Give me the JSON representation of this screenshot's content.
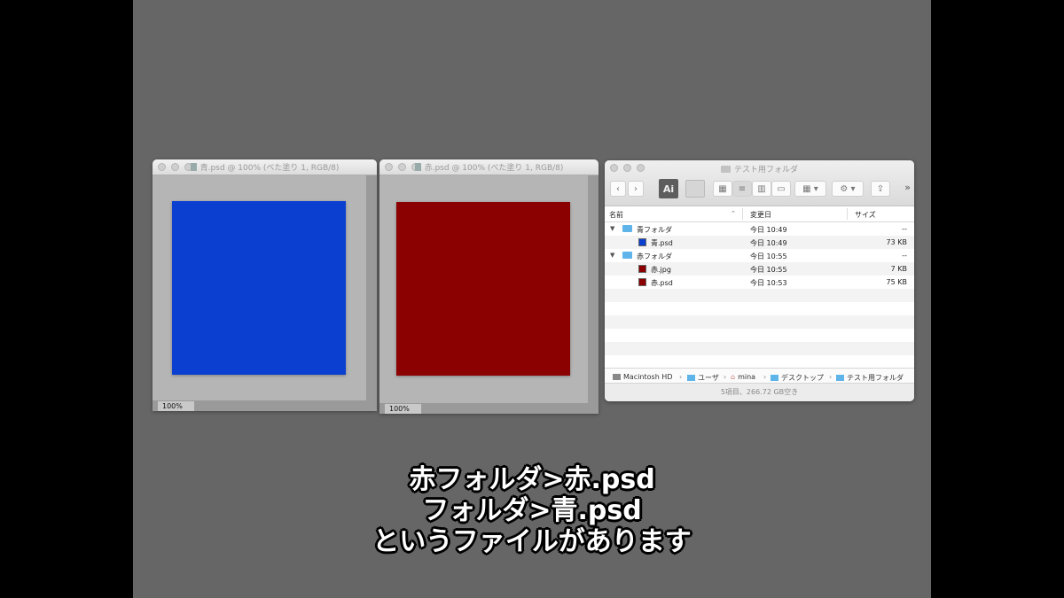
{
  "ps_blue": {
    "title": "青.psd @ 100% (べた塗り 1, RGB/8)",
    "zoom": "100%",
    "fill_color": "#0a3fd0"
  },
  "ps_red": {
    "title": "赤.psd @ 100% (べた塗り 1, RGB/8)",
    "zoom": "100%",
    "fill_color": "#8b0000"
  },
  "finder": {
    "title": "テスト用フォルダ",
    "toolbar": {
      "back_icon": "chevron-left-icon",
      "forward_icon": "chevron-right-icon",
      "ai_label": "Ai",
      "more": "»"
    },
    "columns": {
      "name": "名前",
      "modified": "変更日",
      "size": "サイズ"
    },
    "rows": [
      {
        "name": "青フォルダ",
        "modified": "今日 10:49",
        "size": "--",
        "kind": "folder"
      },
      {
        "name": "青.psd",
        "modified": "今日 10:49",
        "size": "73 KB",
        "kind": "file",
        "color": "#0a3fd0"
      },
      {
        "name": "赤フォルダ",
        "modified": "今日 10:55",
        "size": "--",
        "kind": "folder"
      },
      {
        "name": "赤.jpg",
        "modified": "今日 10:55",
        "size": "7 KB",
        "kind": "file",
        "color": "#8b0000"
      },
      {
        "name": "赤.psd",
        "modified": "今日 10:53",
        "size": "75 KB",
        "kind": "file",
        "color": "#8b0000"
      }
    ],
    "path": [
      "Macintosh HD",
      "ユーザ",
      "mina",
      "デスクトップ",
      "テスト用フォルダ"
    ],
    "status": "5項目、266.72 GB空き"
  },
  "caption": {
    "line1": "赤フォルダ>赤.psd",
    "line2": "フォルダ>青.psd",
    "line3": "というファイルがあります"
  }
}
